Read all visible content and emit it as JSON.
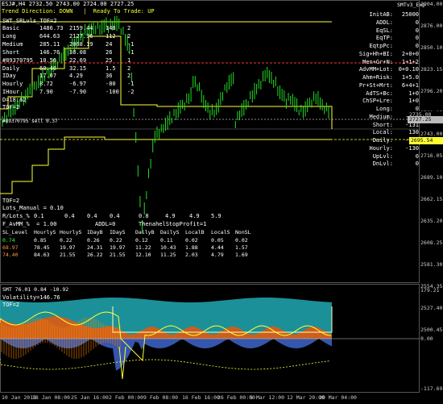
{
  "header": {
    "symbol_bar": "ESJ#,H4 2732.50 2743.00 2724.00 2727.25",
    "trend_line": "Trend Direction: DOWN   |  Ready To Trade: UP",
    "indicator_title": "SMTv3_Exp"
  },
  "colors": {
    "candle": "#22dd22",
    "yellow": "#ffff33",
    "cyan": "#00c8c8",
    "red": "#ff3030",
    "orange": "#ff8800",
    "grid": "#1a1a1a"
  },
  "main_stats": {
    "title": "SWT_SRLvls_TOF=2",
    "rows": [
      {
        "label": "Basic",
        "v1": "1486.73",
        "v2": "2159.44",
        "v3": "148",
        "v4": "2"
      },
      {
        "label": "Long",
        "v1": "644.63",
        "v2": "2127.36",
        "v3": "112",
        "v4": "2"
      },
      {
        "label": "Medium",
        "v1": "285.11",
        "v2": "2068.19",
        "v3": "24",
        "v4": "-1"
      },
      {
        "label": "Short",
        "v1": "146.76",
        "v2": "38.08",
        "v3": "26",
        "v4": "-1"
      },
      {
        "label": "#89370795",
        "v1": "10.56",
        "v2": "22.69",
        "v3": "25",
        "v4": "1"
      },
      {
        "label": "Daily",
        "v1": "60.46",
        "v2": "32.15",
        "v3": "1.5",
        "v4": "2"
      },
      {
        "label": "IDay",
        "v1": "17.07",
        "v2": "4.29",
        "v3": "36",
        "v4": "2"
      },
      {
        "label": "Hourly",
        "v1": "8.72",
        "v2": "-6.97",
        "v3": "-80",
        "v4": "-1"
      },
      {
        "label": "IHour",
        "v1": "7.90",
        "v2": "-7.90",
        "v3": "-100",
        "v4": "-2"
      }
    ],
    "d_line": "D=18.62",
    "tof_line": "TOF=2",
    "trade_line": "#89370795 sell 0.37"
  },
  "lower_block": {
    "tof": "TOF=2",
    "lots": "Lots_Manual = 0.10",
    "rlots_label": "R/Lots_%",
    "rlots": [
      "0.1",
      "0.4",
      "0.4",
      "0.4",
      "0.8",
      "4.9",
      "4.9",
      "5.9"
    ],
    "f_line": "F_AvMM_%  = 1.00",
    "addl": "ADDL=0",
    "tp_line": "ThenahelStopProfit=1",
    "headers": [
      "SL_Level",
      "HourlyS",
      "HourlyS",
      "IDayB",
      "IDayS",
      "DailyB",
      "DailyS",
      "LocalB",
      "LocalS",
      "NonSL"
    ],
    "rows": [
      {
        "c": "#33ff33",
        "vals": [
          "0.74",
          "0.85",
          "0.22",
          "0.26",
          "0.22",
          "0.12",
          "0.11",
          "0.02",
          "0.05",
          "0.02"
        ]
      },
      {
        "c": "#ff9933",
        "vals": [
          "68.97",
          "78.45",
          "19.97",
          "24.31",
          "19.97",
          "11.22",
          "10.43",
          "1.88",
          "4.44",
          "1.57"
        ]
      },
      {
        "c": "#ff9933",
        "vals": [
          "74.40",
          "84.63",
          "21.55",
          "26.22",
          "21.55",
          "12.10",
          "11.25",
          "2.03",
          "4.79",
          "1.69"
        ]
      }
    ]
  },
  "right_list": [
    {
      "label": "InitAB:",
      "val": "25000"
    },
    {
      "label": "ADDL:",
      "val": "0"
    },
    {
      "label": "EqSL:",
      "val": "0"
    },
    {
      "label": "EqTP:",
      "val": "0"
    },
    {
      "label": "EqtpPc:",
      "val": "0"
    },
    {
      "label": "Sig+Hh+BI:",
      "val": "2+0+0"
    },
    {
      "label": "Men+Gr+N:",
      "val": "1+1+2"
    },
    {
      "label": "AdvMM+Lot:",
      "val": "0+0.10"
    },
    {
      "label": "Ahm+Risk:",
      "val": "1+5.0"
    },
    {
      "label": "Pr+St+Mrt:",
      "val": "6+4+1"
    },
    {
      "label": "AdTS+Bc:",
      "val": "1+0"
    },
    {
      "label": "ChSP+Lre:",
      "val": "1+0"
    },
    {
      "label": "Long:",
      "val": "0"
    },
    {
      "label": "Medium:",
      "val": "-131"
    },
    {
      "label": "Short:",
      "val": "-131"
    },
    {
      "label": "Local:",
      "val": "130"
    },
    {
      "label": "Daily:",
      "val": "-131"
    },
    {
      "label": "Hourly:",
      "val": "-130"
    },
    {
      "label": "UpLvl:",
      "val": "0"
    },
    {
      "label": "DnLvl:",
      "val": "0"
    }
  ],
  "price_axis": [
    "2904.00",
    "2876.00",
    "2850.10",
    "2823.15",
    "2796.20",
    "2769.25",
    "2743.00",
    "2716.05",
    "2689.10",
    "2662.15",
    "2635.20",
    "2608.25",
    "2581.30",
    "2554.35",
    "2527.40",
    "2500.45",
    "2473.50"
  ],
  "price_axis_display": [
    {
      "t": "2904.00"
    },
    {
      "t": "2876.00"
    },
    {
      "t": "2850.10"
    },
    {
      "t": "2823.15"
    },
    {
      "t": "2796.20"
    },
    {
      "t": "2769.25"
    },
    {
      "t": "2743.00"
    },
    {
      "t": "2716.05"
    },
    {
      "t": "2689.10"
    },
    {
      "t": "2662.15"
    },
    {
      "t": "2635.20"
    },
    {
      "t": "2608.25"
    },
    {
      "t": "2581.30"
    },
    {
      "t": "2554.35"
    },
    {
      "t": "2527.40"
    },
    {
      "t": "2500.45"
    }
  ],
  "price_tags": [
    {
      "t": "2735.00",
      "bg": "#000000",
      "fg": "#cccccc"
    },
    {
      "t": "2727.25",
      "bg": "#bbbbbb",
      "fg": "#000000"
    },
    {
      "t": "2695.54",
      "bg": "#ffff33",
      "fg": "#000000"
    }
  ],
  "indicator": {
    "title": "SMT 76.01 0.84 -10.92",
    "volatility": "Volatility=146.76",
    "tof": "TOF=2",
    "axis_top": "179.21",
    "axis_mid": "0.00",
    "axis_bottom": "-117.69"
  },
  "x_axis": [
    "10 Jan 2018",
    "18 Jan 08:00",
    "25 Jan 16:00",
    "2 Feb 00:00",
    "9 Feb 08:00",
    "16 Feb 16:00",
    "26 Feb 00:00",
    "5 Mar 12:00",
    "12 Mar 20:00",
    "20 Mar 04:00"
  ]
}
